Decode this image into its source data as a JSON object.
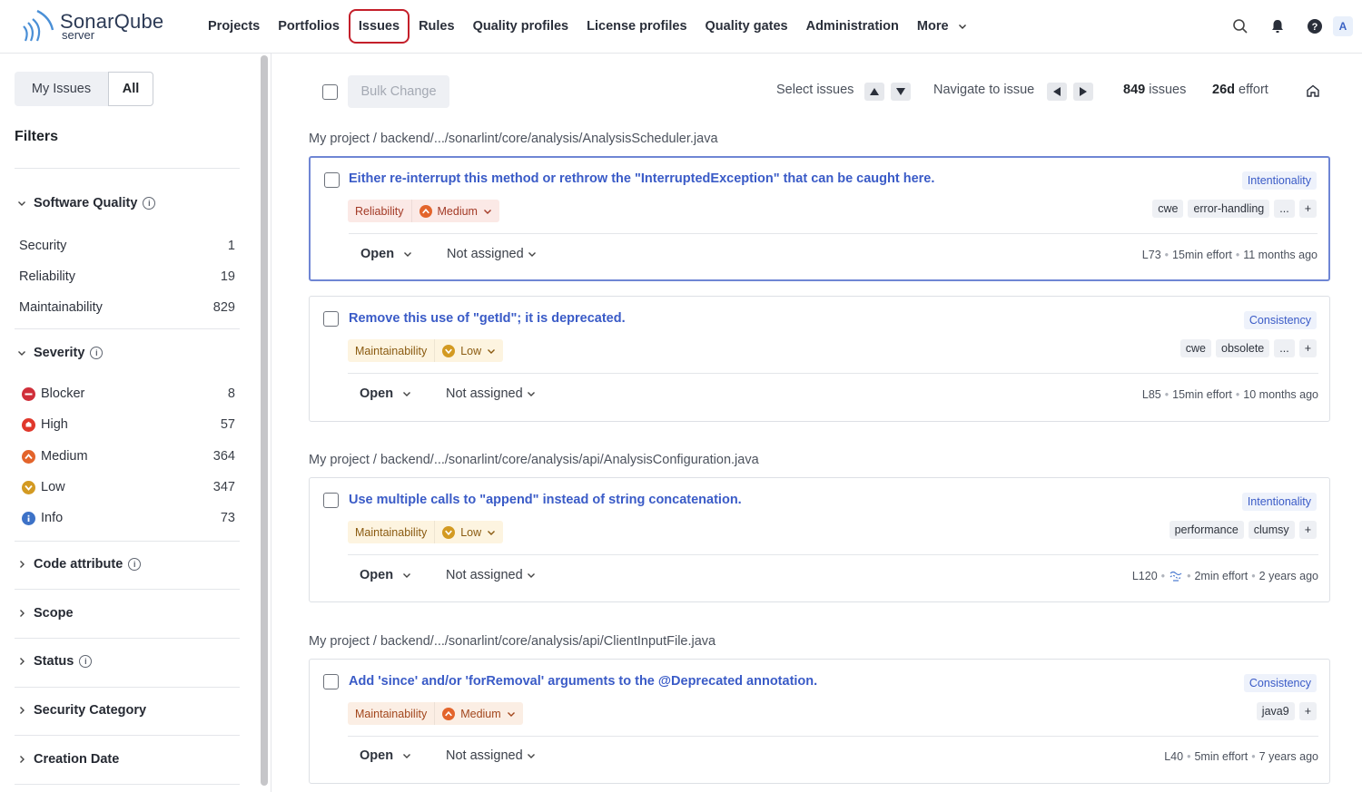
{
  "header": {
    "brand": "SonarQube",
    "brand_sub": "server",
    "nav": [
      {
        "label": "Projects"
      },
      {
        "label": "Portfolios"
      },
      {
        "label": "Issues"
      },
      {
        "label": "Rules"
      },
      {
        "label": "Quality profiles"
      },
      {
        "label": "License profiles"
      },
      {
        "label": "Quality gates"
      },
      {
        "label": "Administration"
      },
      {
        "label": "More"
      }
    ],
    "avatar": "A"
  },
  "sidebar": {
    "my_issues": "My Issues",
    "all": "All",
    "filters_title": "Filters",
    "software_quality": {
      "title": "Software Quality",
      "items": [
        {
          "label": "Security",
          "count": "1"
        },
        {
          "label": "Reliability",
          "count": "19"
        },
        {
          "label": "Maintainability",
          "count": "829"
        }
      ]
    },
    "severity": {
      "title": "Severity",
      "items": [
        {
          "label": "Blocker",
          "count": "8",
          "color": "#d02f3a"
        },
        {
          "label": "High",
          "count": "57",
          "color": "#e0382c"
        },
        {
          "label": "Medium",
          "count": "364",
          "color": "#e3642b"
        },
        {
          "label": "Low",
          "count": "347",
          "color": "#d39a22"
        },
        {
          "label": "Info",
          "count": "73",
          "color": "#3d72c7"
        }
      ]
    },
    "collapsed_facets": [
      "Code attribute",
      "Scope",
      "Status",
      "Security Category",
      "Creation Date"
    ]
  },
  "toolbar": {
    "bulk_change": "Bulk Change",
    "select_issues": "Select issues",
    "navigate_to_issue": "Navigate to issue",
    "issues_count": "849",
    "issues_label": "issues",
    "effort_value": "26d",
    "effort_label": "effort"
  },
  "groups": [
    {
      "path": "My project / backend/.../sonarlint/core/analysis/AnalysisScheduler.java",
      "issues": [
        {
          "title": "Either re-interrupt this method or rethrow the \"InterruptedException\" that can be caught here.",
          "attribute": "Intentionality",
          "quality": "Reliability",
          "severity": "Medium",
          "tags": [
            "cwe",
            "error-handling",
            "...",
            "+"
          ],
          "status": "Open",
          "assignee": "Not assigned",
          "line": "L73",
          "effort": "15min effort",
          "age": "11 months ago"
        },
        {
          "title": "Remove this use of \"getId\"; it is deprecated.",
          "attribute": "Consistency",
          "quality": "Maintainability",
          "severity": "Low",
          "tags": [
            "cwe",
            "obsolete",
            "...",
            "+"
          ],
          "status": "Open",
          "assignee": "Not assigned",
          "line": "L85",
          "effort": "15min effort",
          "age": "10 months ago"
        }
      ]
    },
    {
      "path": "My project / backend/.../sonarlint/core/analysis/api/AnalysisConfiguration.java",
      "issues": [
        {
          "title": "Use multiple calls to \"append\" instead of string concatenation.",
          "attribute": "Intentionality",
          "quality": "Maintainability",
          "severity": "Low",
          "tags": [
            "performance",
            "clumsy",
            "+"
          ],
          "status": "Open",
          "assignee": "Not assigned",
          "line": "L120",
          "effort": "2min effort",
          "age": "2 years ago"
        }
      ]
    },
    {
      "path": "My project / backend/.../sonarlint/core/analysis/api/ClientInputFile.java",
      "issues": [
        {
          "title": "Add 'since' and/or 'forRemoval' arguments to the @Deprecated annotation.",
          "attribute": "Consistency",
          "quality": "Maintainability",
          "severity": "Medium",
          "tags": [
            "java9",
            "+"
          ],
          "status": "Open",
          "assignee": "Not assigned",
          "line": "L40",
          "effort": "5min effort",
          "age": "7 years ago"
        }
      ]
    }
  ],
  "colors": {
    "accent": "#3a5bc7",
    "active_nav_outline": "#c41f2a",
    "selected_card_border": "#6f86d4"
  }
}
